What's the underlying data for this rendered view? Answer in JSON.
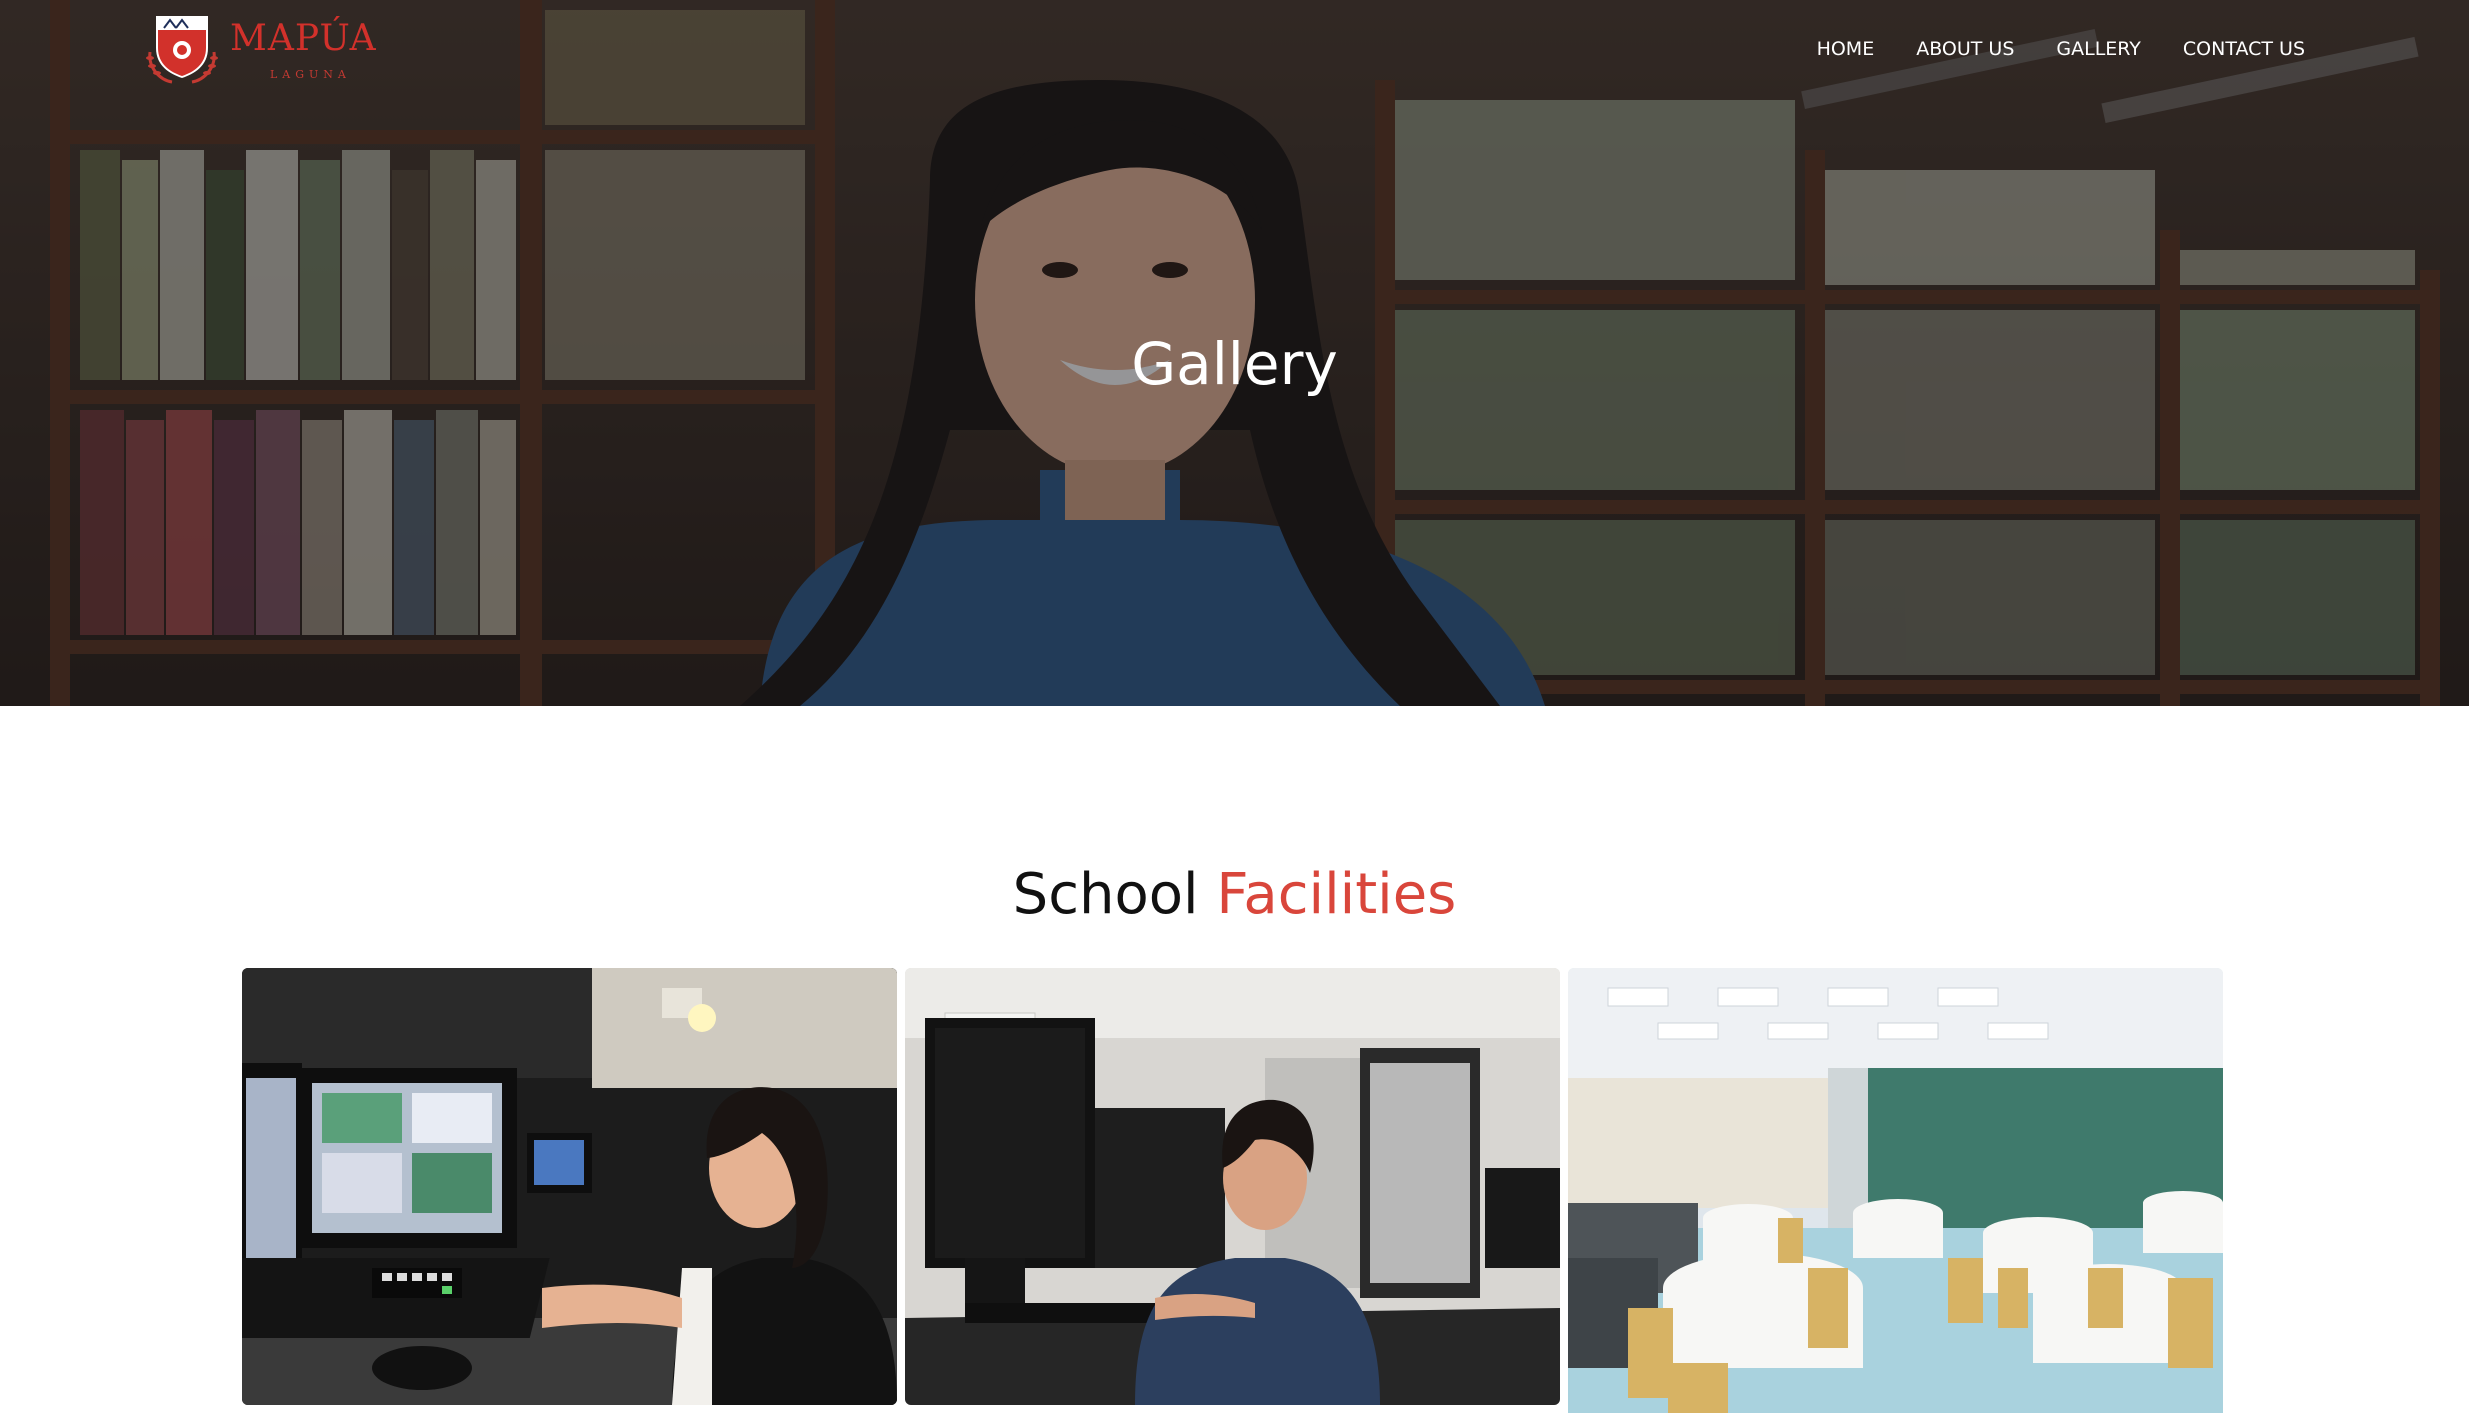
{
  "brand": {
    "name": "MAPÚA",
    "sub": "LAGUNA",
    "accent_color": "#d2312b"
  },
  "nav": {
    "items": [
      "HOME",
      "ABOUT US",
      "GALLERY",
      "CONTACT US"
    ]
  },
  "hero": {
    "title": "Gallery"
  },
  "section": {
    "title_plain": "School ",
    "title_accent": "Facilities",
    "accent_color": "#d9463b"
  },
  "gallery": {
    "tiles": [
      {
        "icon": "broadcast-studio-photo"
      },
      {
        "icon": "computer-lab-photo"
      },
      {
        "icon": "dining-hall-photo"
      }
    ]
  }
}
